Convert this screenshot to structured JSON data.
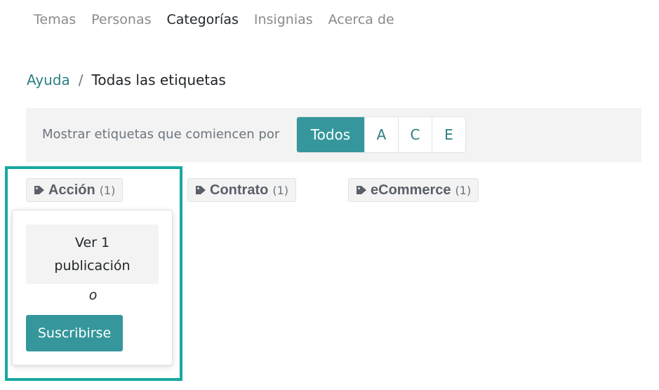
{
  "nav": {
    "items": [
      {
        "label": "Temas",
        "active": false
      },
      {
        "label": "Personas",
        "active": false
      },
      {
        "label": "Categorías",
        "active": true
      },
      {
        "label": "Insignias",
        "active": false
      },
      {
        "label": "Acerca de",
        "active": false
      }
    ]
  },
  "breadcrumb": {
    "parent": "Ayuda",
    "separator": "/",
    "current": "Todas las etiquetas"
  },
  "filter": {
    "label": "Mostrar etiquetas que comiencen por",
    "letters": [
      "Todos",
      "A",
      "C",
      "E"
    ],
    "selected": "Todos"
  },
  "tags": [
    {
      "name": "Acción",
      "count": "(1)",
      "icon": "tag-icon"
    },
    {
      "name": "Contrato",
      "count": "(1)",
      "icon": "tag-icon"
    },
    {
      "name": "eCommerce",
      "count": "(1)",
      "icon": "tag-icon"
    }
  ],
  "popover": {
    "view_label": "Ver 1 publicación",
    "or_label": "o",
    "subscribe_label": "Suscribirse"
  },
  "colors": {
    "accent": "#35979c",
    "link": "#2d7f83",
    "highlight": "#17a8a1"
  }
}
